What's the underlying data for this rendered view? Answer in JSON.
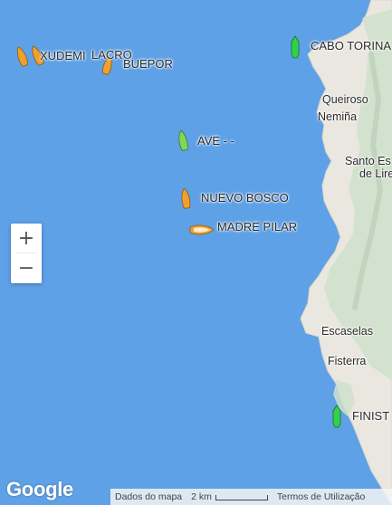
{
  "vessels": [
    {
      "name": "XUDEMI",
      "color": "#f0a030"
    },
    {
      "name": "LACRO",
      "color": "#f0a030"
    },
    {
      "name": "BUEPOR",
      "color": "#f0a030"
    },
    {
      "name": "AVE - -",
      "color": "#7ed957"
    },
    {
      "name": "NUEVO BOSCO",
      "color": "#f0a030"
    },
    {
      "name": "MADRE PILAR",
      "color": "#f0a030"
    },
    {
      "name": "CABO TORINA",
      "color": "#33d14a"
    },
    {
      "name": "FINIST",
      "color": "#33d14a"
    }
  ],
  "places": {
    "queiroso": "Queiroso",
    "nemina": "Nemiña",
    "santo_es": "Santo Es",
    "de_lir": "de Lire",
    "escaselas": "Escaselas",
    "fisterra": "Fisterra"
  },
  "zoom": {
    "in": "+",
    "out": "−"
  },
  "footer": {
    "google": "Google",
    "map_data": "Dados do mapa",
    "scale": "2 km",
    "terms": "Termos de Utilização"
  },
  "colors": {
    "sea": "#5fa1e6",
    "land": "#e9e7df",
    "terrain": "#cfe0cc"
  }
}
